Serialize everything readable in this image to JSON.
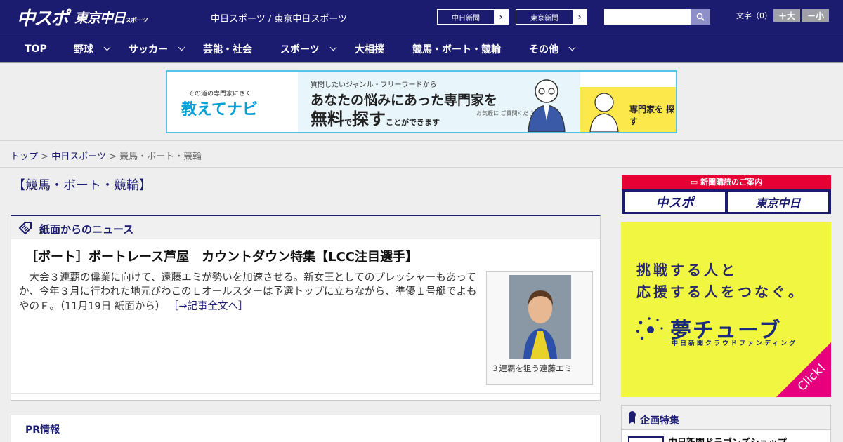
{
  "header": {
    "logo_chuspo": "中スポ",
    "logo_tokyo": "東京中日",
    "logo_tokyo_sub": "スポーツ",
    "site_title": "中日スポーツ / 東京中日スポーツ",
    "paper_buttons": [
      "中日新聞",
      "東京新聞"
    ],
    "search_placeholder": "",
    "font_label": "文字（0）",
    "font_larger": "＋大",
    "font_smaller": "－小"
  },
  "nav": {
    "items": [
      {
        "label": "TOP",
        "dropdown": false
      },
      {
        "label": "野球",
        "dropdown": true
      },
      {
        "label": "サッカー",
        "dropdown": true
      },
      {
        "label": "芸能・社会",
        "dropdown": false
      },
      {
        "label": "スポーツ",
        "dropdown": true
      },
      {
        "label": "大相撲",
        "dropdown": false
      },
      {
        "label": "競馬・ボート・競輪",
        "dropdown": false
      },
      {
        "label": "その他",
        "dropdown": true
      }
    ]
  },
  "ad_banner": {
    "tagline_small": "その道の専門家にきく",
    "logo": "教えてナビ",
    "line1": "質問したいジャンル・フリーワードから",
    "line2": "あなたの悩みにあった専門家を",
    "line3_a": "無料",
    "line3_b": "で",
    "line3_c": "探す",
    "line3_d": "ことができます",
    "note": "お気軽に ご質問ください!",
    "cta": "専門家を 探す",
    "accent": "#57c3e8"
  },
  "breadcrumb": {
    "home": "トップ",
    "sep": ">",
    "section": "中日スポーツ",
    "current": "競馬・ボート・競輪"
  },
  "main": {
    "page_title": "【競馬・ボート・競輪】",
    "news_section_label": "紙面からのニュース",
    "article": {
      "title": "［ボート］ボートレース芦屋　カウントダウン特集【LCC注目選手】",
      "body": "大会３連覇の偉業に向けて、遠藤エミが勢いを加速させる。新女王としてのプレッシャーもあってか、今年３月に行われた地元びわこのＬオールスターは予選トップに立ちながら、準優１号艇でよもやのＦ。（11月19日 紙面から）",
      "more": "［→記事全文へ］",
      "photo_caption": "３連覇を狙う遠藤エミ"
    },
    "pr_label": "PR情報"
  },
  "sidebar": {
    "subscribe_head": "新聞購読のご案内",
    "subscribe_chuspo": "中スポ",
    "subscribe_tokyo": "東京中日",
    "yume_lines": [
      "挑戦する人と",
      "応援する人をつなぐ。"
    ],
    "yume_brand": "夢チューブ",
    "yume_brand_sub": "中日新聞クラウドファンディング",
    "yume_click": "Click!",
    "kikaku_label": "企画特集",
    "kikaku_item": "中日新聞ドラゴンズショップ"
  },
  "colors": {
    "brand_navy": "#1b1b6f",
    "subscribe_red": "#e60033",
    "yume_yellow": "#f1f640",
    "yume_pink": "#e6007e"
  }
}
